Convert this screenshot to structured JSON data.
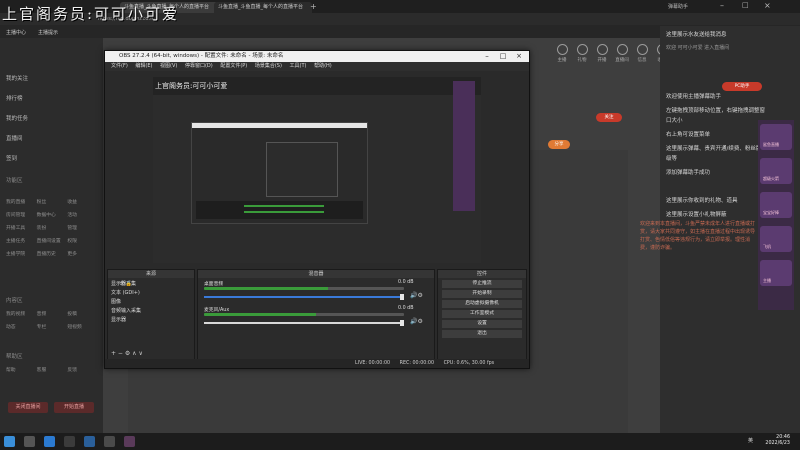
{
  "browser": {
    "tabs": [
      "斗鱼直播_斗鱼直播_每个人的直播平台",
      "斗鱼直播_斗鱼直播_每个人的直播平台"
    ],
    "overlay_title": "上官阁务员:可可小可爱",
    "address": "https://mp.douyu.com",
    "right_label": "弹幕助手",
    "bookmarks": [
      "主播中心",
      "主播提示"
    ]
  },
  "sidebar": {
    "items": [
      "我的关注",
      "排行榜",
      "我的任务",
      "直播间",
      "签到"
    ],
    "section1": "功能区",
    "grid1": [
      "我的直播",
      "粉丝",
      "收益",
      "房间管理",
      "数据中心",
      "活动",
      "开播工具",
      "装扮",
      "管理",
      "主播任务",
      "直播间设置",
      "权限",
      "主播学院",
      "直播历史",
      "更多"
    ],
    "section2": "内容区",
    "grid2": [
      "我的视频",
      "音频",
      "投稿",
      "动态",
      "专栏",
      "短视频"
    ],
    "section3": "帮助区",
    "grid3": [
      "帮助",
      "客服",
      "反馈"
    ],
    "btn_left": "关闭直播间",
    "btn_right": "开始直播"
  },
  "top_icons": [
    "主播",
    "礼物",
    "开播",
    "直播间",
    "信息",
    "收益"
  ],
  "right_panel": {
    "header": "这里展示水友送给我消息",
    "user_line": "欢迎 可可小可爱 进入直播间",
    "lines": [
      "欢迎使用主播弹幕助手",
      "左键拖拽顶部移动位置，右键拖拽调整窗",
      "口大小",
      "右上角可设置菜单",
      "这里展示弹幕、贵宾开通/续费、粉丝牌升",
      "级等",
      "添加弹幕助手成功",
      "这里展示你收到的礼物、道具",
      "这里展示设置小礼物屏蔽"
    ],
    "pill_top": "PC助手",
    "pill_mid": "关注",
    "pill_low": "分享"
  },
  "chat_red": "欢迎来到本直播间，斗鱼严禁未成年人进行直播或打赏，请大家共同遵守，如主播在直播过程中出现诱导打赏、色情低俗等违规行为，请立即举报。理性消费，谨防诈骗。",
  "gifts": [
    "鲨鱼直播",
    "超级火箭",
    "宝宝好棒",
    "飞机",
    "主播"
  ],
  "obs": {
    "title": "OBS 27.2.4 (64-bit, windows) - 配置文件: 未命名 - 场景: 未命名",
    "menu": [
      "文件(F)",
      "编辑(E)",
      "视图(V)",
      "停靠窗口(D)",
      "配置文件(P)",
      "场景集合(S)",
      "工具(T)",
      "帮助(H)"
    ],
    "nested_title": "上官阁务员:可可小可爱",
    "docks": {
      "sources_head": "来源",
      "mixer_head": "混音器",
      "controls_head": "控件"
    },
    "sources": [
      "显示器采集",
      "文本 (GDI+)",
      "图像",
      "音频输入采集",
      "显示器"
    ],
    "mixer": [
      {
        "name": "桌面音频",
        "db": "0.0 dB",
        "level": 0.62
      },
      {
        "name": "麦克风/Aux",
        "db": "0.0 dB",
        "level": 0.56
      }
    ],
    "controls": [
      "停止推流",
      "开始录制",
      "启动虚拟摄像机",
      "工作室模式",
      "设置",
      "退出"
    ],
    "status": {
      "live": "LIVE: 00:00:00",
      "rec": "REC: 00:00:00",
      "cpu": "CPU: 0.6%, 30.00 fps"
    }
  },
  "taskbar": {
    "time": "20:46",
    "date": "2022/6/23",
    "ime": "英"
  }
}
